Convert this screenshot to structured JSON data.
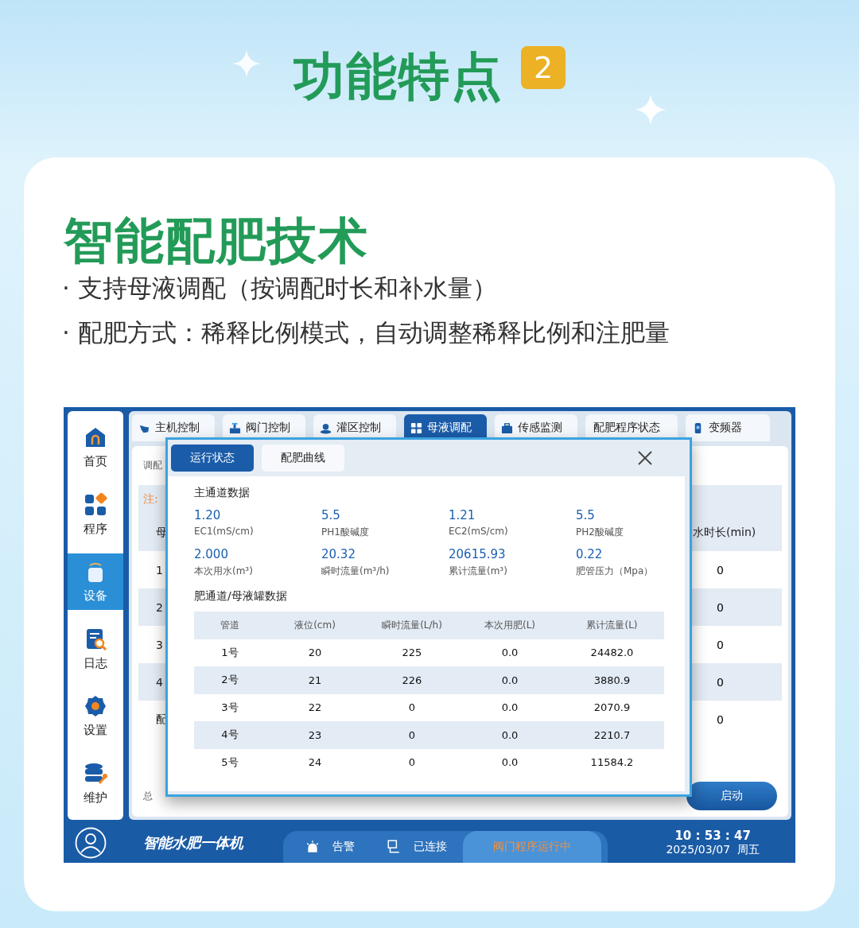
{
  "header": {
    "title": "功能特点",
    "badge": "2"
  },
  "section": {
    "title": "智能配肥技术",
    "bullets": [
      "· 支持母液调配（按调配时长和补水量）",
      "· 配肥方式：稀释比例模式，自动调整稀释比例和注肥量"
    ]
  },
  "sidebar": [
    {
      "label": "首页",
      "selected": false
    },
    {
      "label": "程序",
      "selected": false
    },
    {
      "label": "设备",
      "selected": true
    },
    {
      "label": "日志",
      "selected": false
    },
    {
      "label": "设置",
      "selected": false
    },
    {
      "label": "维护",
      "selected": false
    }
  ],
  "tabs": [
    {
      "label": "主机控制",
      "selected": false
    },
    {
      "label": "阀门控制",
      "selected": false
    },
    {
      "label": "灌区控制",
      "selected": false
    },
    {
      "label": "母液调配",
      "selected": true
    },
    {
      "label": "传感监测",
      "selected": false
    },
    {
      "label": "配肥程序状态",
      "selected": false
    },
    {
      "label": "变频器",
      "selected": false
    }
  ],
  "panel": {
    "title": "调配",
    "note": "注:",
    "header_left": "母",
    "header_right": "水时长(min)",
    "rows": [
      {
        "label": "1",
        "value": "0"
      },
      {
        "label": "2",
        "value": "0"
      },
      {
        "label": "3",
        "value": "0"
      },
      {
        "label": "4",
        "value": "0"
      },
      {
        "label": "配",
        "value": "0"
      }
    ],
    "footer": "总",
    "button": "启动"
  },
  "dialog": {
    "tabs": [
      {
        "label": "运行状态",
        "selected": true
      },
      {
        "label": "配肥曲线",
        "selected": false
      }
    ],
    "main_title": "主通道数据",
    "metrics": [
      {
        "value": "1.20",
        "label": "EC1(mS/cm)"
      },
      {
        "value": "5.5",
        "label": "PH1酸碱度"
      },
      {
        "value": "1.21",
        "label": "EC2(mS/cm)"
      },
      {
        "value": "5.5",
        "label": "PH2酸碱度"
      },
      {
        "value": "2.000",
        "label": "本次用水(m³)"
      },
      {
        "value": "20.32",
        "label": "瞬时流量(m³/h)"
      },
      {
        "value": "20615.93",
        "label": "累计流量(m³)"
      },
      {
        "value": "0.22",
        "label": "肥管压力（Mpa）"
      }
    ],
    "table_title": "肥通道/母液罐数据",
    "columns": [
      "管道",
      "液位(cm)",
      "瞬时流量(L/h)",
      "本次用肥(L)",
      "累计流量(L)"
    ],
    "rows": [
      [
        "1号",
        "20",
        "225",
        "0.0",
        "24482.0"
      ],
      [
        "2号",
        "21",
        "226",
        "0.0",
        "3880.9"
      ],
      [
        "3号",
        "22",
        "0",
        "0.0",
        "2070.9"
      ],
      [
        "4号",
        "23",
        "0",
        "0.0",
        "2210.7"
      ],
      [
        "5号",
        "24",
        "0",
        "0.0",
        "11584.2"
      ]
    ]
  },
  "status_bar": {
    "brand": "智能水肥一体机",
    "items": [
      {
        "label": "告警"
      },
      {
        "label": "已连接"
      },
      {
        "label": "阀门程序运行中"
      }
    ],
    "time": "10 : 53 : 47",
    "date": "2025/03/07  周五"
  }
}
